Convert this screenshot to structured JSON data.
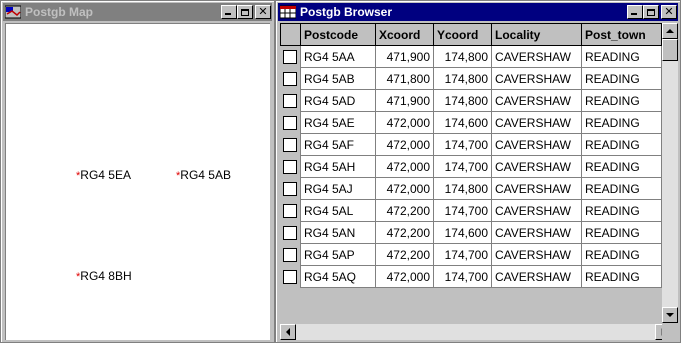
{
  "map_window": {
    "title": "Postgb Map",
    "icon": "map-app-icon",
    "labels": [
      {
        "text": "RG4 5EA"
      },
      {
        "text": "RG4 5AB"
      },
      {
        "text": "RG4 8BH"
      }
    ],
    "marker_color": "#e00000"
  },
  "browser_window": {
    "title": "Postgb Browser",
    "icon": "grid-app-icon",
    "columns": [
      "Postcode",
      "Xcoord",
      "Ycoord",
      "Locality",
      "Post_town"
    ],
    "rows": [
      [
        "RG4 5AA",
        "471,900",
        "174,800",
        "CAVERSHAW",
        "READING"
      ],
      [
        "RG4 5AB",
        "471,800",
        "174,800",
        "CAVERSHAW",
        "READING"
      ],
      [
        "RG4 5AD",
        "471,900",
        "174,800",
        "CAVERSHAW",
        "READING"
      ],
      [
        "RG4 5AE",
        "472,000",
        "174,600",
        "CAVERSHAW",
        "READING"
      ],
      [
        "RG4 5AF",
        "472,000",
        "174,700",
        "CAVERSHAW",
        "READING"
      ],
      [
        "RG4 5AH",
        "472,000",
        "174,700",
        "CAVERSHAW",
        "READING"
      ],
      [
        "RG4 5AJ",
        "472,000",
        "174,800",
        "CAVERSHAW",
        "READING"
      ],
      [
        "RG4 5AL",
        "472,200",
        "174,700",
        "CAVERSHAW",
        "READING"
      ],
      [
        "RG4 5AN",
        "472,200",
        "174,600",
        "CAVERSHAW",
        "READING"
      ],
      [
        "RG4 5AP",
        "472,200",
        "174,700",
        "CAVERSHAW",
        "READING"
      ],
      [
        "RG4 5AQ",
        "472,000",
        "174,700",
        "CAVERSHAW",
        "READING"
      ]
    ]
  },
  "colors": {
    "active_title": "#000080",
    "inactive_title": "#808080",
    "face": "#c0c0c0"
  }
}
